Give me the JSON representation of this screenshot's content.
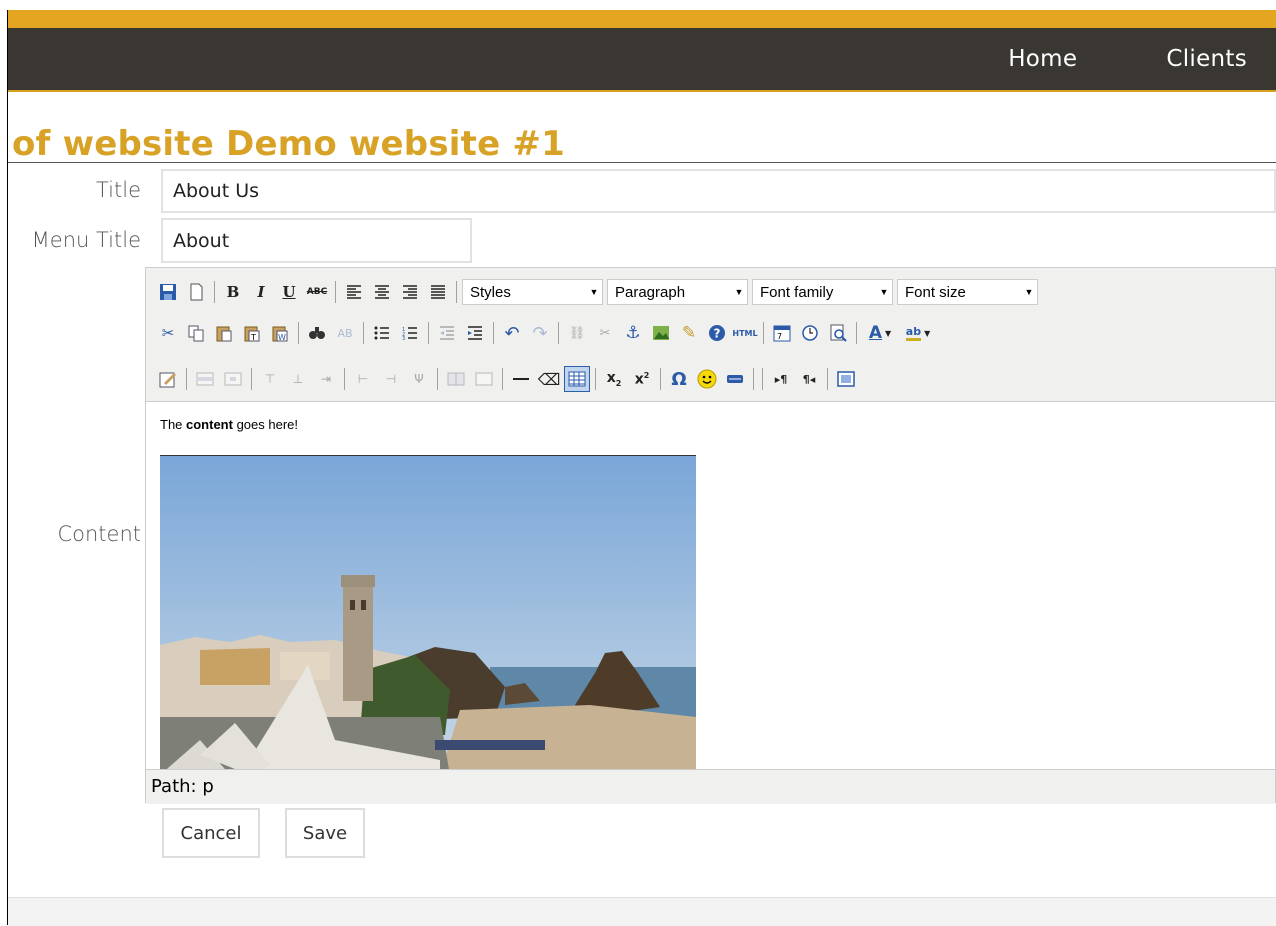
{
  "nav": {
    "items": [
      "Home",
      "Clients"
    ]
  },
  "page": {
    "title": "of website Demo website #1"
  },
  "form": {
    "title_label": "Title",
    "title_value": "About Us",
    "menu_title_label": "Menu Title",
    "menu_title_value": "About",
    "content_label": "Content",
    "cancel_label": "Cancel",
    "save_label": "Save"
  },
  "editor": {
    "selects": {
      "styles": "Styles",
      "format": "Paragraph",
      "font_family": "Font family",
      "font_size": "Font size"
    },
    "content_text_prefix": "The ",
    "content_text_bold": "content",
    "content_text_suffix": " goes here!",
    "status_path": "Path: p",
    "html_button_label": "HTML"
  },
  "colors": {
    "accent": "#e4a620",
    "title": "#d7a225",
    "nav_bg": "#3a3632"
  }
}
